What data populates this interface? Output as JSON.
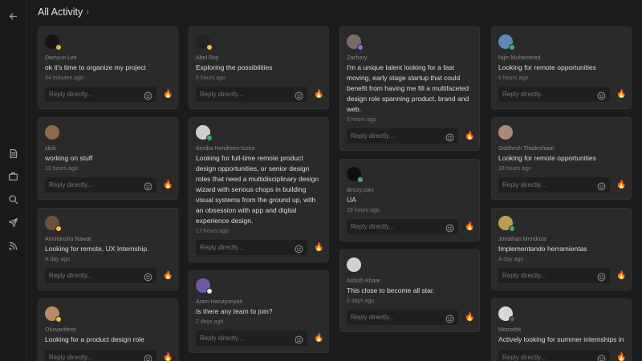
{
  "header": {
    "title": "All Activity",
    "sort_glyph": "↕"
  },
  "reply_placeholder": "Reply directly...",
  "fire_glyph": "🔥",
  "columns": [
    [
      {
        "name": "Damyun Lee",
        "msg": "ok it's time to organize my project",
        "time": "44 minutes ago",
        "avatar": "#141414",
        "badge": "#e3b82a"
      },
      {
        "name": "slick",
        "msg": "working on stuff",
        "time": "12 hours ago",
        "avatar": "#8d6b4a",
        "badge": ""
      },
      {
        "name": "Armitanshu Rawat",
        "msg": "Looking for remote, UX Internship.",
        "time": "A day ago",
        "avatar": "#6d5038",
        "badge": "#f2c33a"
      },
      {
        "name": "Oluwanifemi",
        "msg": "Looking for a product design role",
        "time": "",
        "avatar": "#b98b66",
        "badge": "#f2c33a"
      }
    ],
    [
      {
        "name": "Abel Roy",
        "msg": "Exploring the possibilities",
        "time": "5 hours ago",
        "avatar": "#222222",
        "badge": "#f2c33a"
      },
      {
        "name": "Annika Hendreen-Izzira",
        "msg": "Looking for full-time remote product design opportunities, or senior design roles that need a multidisciplinary design wizard with serious chops in building visual systems from the ground up, with an obsession with app and digital experience design.",
        "time": "17 hours ago",
        "avatar": "#cfcfcf",
        "badge": "#3cb06a"
      },
      {
        "name": "Aram Harutyunyan",
        "msg": "Is there any team to join?",
        "time": "2 days ago",
        "avatar": "#6e58a8",
        "badge": "#e6e6e6"
      }
    ],
    [
      {
        "name": "Zachary",
        "msg": "I'm a unique talent looking for a fast moving, early stage startup that could benefit from having me fill a multifaceted design role spanning product, brand and web.",
        "time": "5 hours ago",
        "avatar": "#7a6a6a",
        "badge": "#8e6ad8"
      },
      {
        "name": "dmrzy.com",
        "msg": "UA",
        "time": "19 hours ago",
        "avatar": "#0f0f0f",
        "badge": "#3cb06a"
      },
      {
        "name": "Ashish Khare",
        "msg": "This close to become all star.",
        "time": "2 days ago",
        "avatar": "#d0d0d0",
        "badge": ""
      }
    ],
    [
      {
        "name": "Nijin Muhammed",
        "msg": "Looking for remote opportunities",
        "time": "6 hours ago",
        "avatar": "#5f87b9",
        "badge": "#3cb06a"
      },
      {
        "name": "Siddhesh Thadeshwar",
        "msg": "Looking for remote opportunities",
        "time": "18 hours ago",
        "avatar": "#a88c78",
        "badge": ""
      },
      {
        "name": "Jonathan Mendoza",
        "msg": "Implementando herramientas",
        "time": "A day ago",
        "avatar": "#c09a55",
        "badge": "#3cb06a"
      },
      {
        "name": "Monsebk",
        "msg": "Actively looking for summer internships in",
        "time": "",
        "avatar": "#d8d8d8",
        "badge": "#555555"
      }
    ]
  ]
}
